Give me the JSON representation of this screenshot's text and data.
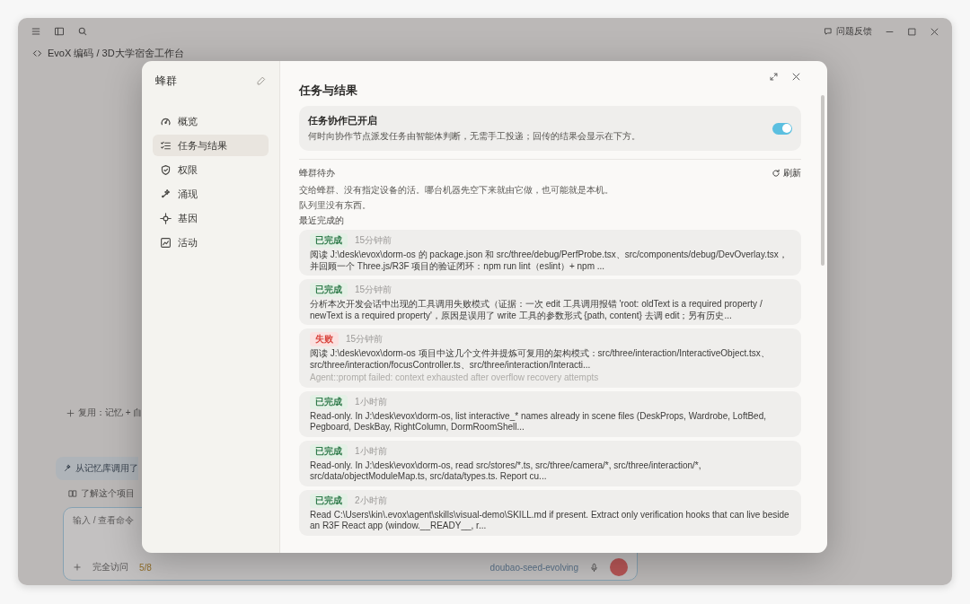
{
  "background": {
    "breadcrumb": "EvoX 编码 / 3D大学宿舍工作台",
    "feedback": "问题反馈",
    "reuse": "复用：记忆 + 自",
    "memory_chip": "从记忆库调用了",
    "suggestion": "了解这个项目",
    "composer": {
      "placeholder": "输入 / 查看命令",
      "access": "完全访问",
      "count": "5/8",
      "model": "doubao-seed-evolving"
    }
  },
  "modal": {
    "title": "蜂群",
    "nav": [
      {
        "label": "概览",
        "selected": false
      },
      {
        "label": "任务与结果",
        "selected": true
      },
      {
        "label": "权限",
        "selected": false
      },
      {
        "label": "涌现",
        "selected": false
      },
      {
        "label": "基因",
        "selected": false
      },
      {
        "label": "活动",
        "selected": false
      }
    ],
    "section_title": "任务与结果",
    "collab": {
      "title": "任务协作已开启",
      "description": "何时向协作节点派发任务由智能体判断，无需手工投递；回传的结果会显示在下方。",
      "on": true
    },
    "queue": {
      "title": "蜂群待办",
      "refresh": "刷新",
      "description": "交给蜂群、没有指定设备的活。哪台机器先空下来就由它做，也可能就是本机。",
      "empty": "队列里没有东西。"
    },
    "recent_title": "最近完成的",
    "tasks": [
      {
        "kind": "done",
        "status_label": "已完成",
        "time": "15分钟前",
        "text": "阅读 J:\\desk\\evox\\dorm-os 的 package.json 和 src/three/debug/PerfProbe.tsx、src/components/debug/DevOverlay.tsx，并回顾一个 Three.js/R3F 项目的验证闭环：npm run lint（eslint）+ npm ..."
      },
      {
        "kind": "done",
        "status_label": "已完成",
        "time": "15分钟前",
        "text": "分析本次开发会话中出现的工具调用失败模式（证据：一次 edit 工具调用报错 'root: oldText is a required property / newText is a required property'，原因是误用了 write 工具的参数形式 {path, content} 去调 edit；另有历史..."
      },
      {
        "kind": "failed",
        "status_label": "失败",
        "time": "15分钟前",
        "text": "阅读 J:\\desk\\evox\\dorm-os 项目中这几个文件并提炼可复用的架构模式：src/three/interaction/InteractiveObject.tsx、src/three/interaction/focusController.ts、src/three/interaction/Interacti...",
        "error": "Agent::prompt failed: context exhausted after overflow recovery attempts"
      },
      {
        "kind": "done",
        "status_label": "已完成",
        "time": "1小时前",
        "text": "Read-only. In J:\\desk\\evox\\dorm-os, list interactive_* names already in scene files (DeskProps, Wardrobe, LoftBed, Pegboard, DeskBay, RightColumn, DormRoomShell..."
      },
      {
        "kind": "done",
        "status_label": "已完成",
        "time": "1小时前",
        "text": "Read-only. In J:\\desk\\evox\\dorm-os, read src/stores/*.ts, src/three/camera/*, src/three/interaction/*, src/data/objectModuleMap.ts, src/data/types.ts. Report cu..."
      },
      {
        "kind": "done",
        "status_label": "已完成",
        "time": "2小时前",
        "text": "Read C:\\Users\\kin\\.evox\\agent\\skills\\visual-demo\\SKILL.md if present. Extract only verification hooks that can live beside an R3F React app (window.__READY__, r..."
      }
    ]
  }
}
